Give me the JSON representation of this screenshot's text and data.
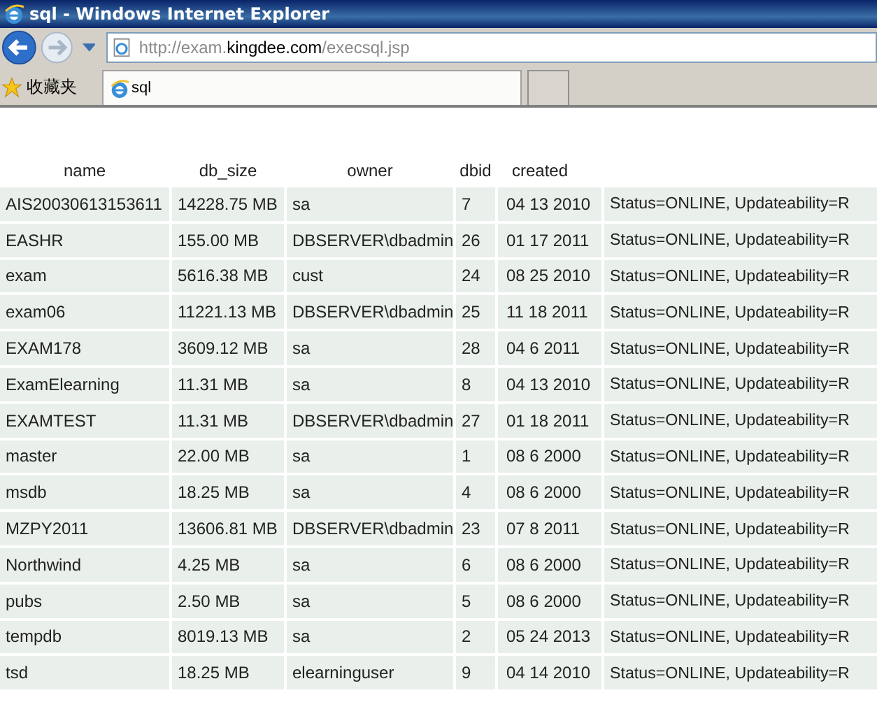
{
  "window": {
    "title": "sql - Windows Internet Explorer"
  },
  "address_bar": {
    "host_prefix": "http://exam.",
    "domain": "kingdee.com",
    "path": "/execsql.jsp"
  },
  "favorites_bar": {
    "label": "收藏夹"
  },
  "tabs": [
    {
      "label": "sql",
      "selected": true
    }
  ],
  "table": {
    "columns": [
      "name",
      "db_size",
      "owner",
      "dbid",
      "created"
    ],
    "rows": [
      [
        "AIS20030613153611",
        "14228.75 MB",
        "sa",
        "7",
        "04 13 2010",
        "Status=ONLINE, Updateability=R"
      ],
      [
        "EASHR",
        "155.00 MB",
        "DBSERVER\\dbadmin",
        "26",
        "01 17 2011",
        "Status=ONLINE, Updateability=R"
      ],
      [
        "exam",
        "5616.38 MB",
        "cust",
        "24",
        "08 25 2010",
        "Status=ONLINE, Updateability=R"
      ],
      [
        "exam06",
        "11221.13 MB",
        "DBSERVER\\dbadmin",
        "25",
        "11 18 2011",
        "Status=ONLINE, Updateability=R"
      ],
      [
        "EXAM178",
        "3609.12 MB",
        "sa",
        "28",
        "04 6 2011",
        "Status=ONLINE, Updateability=R"
      ],
      [
        "ExamElearning",
        "11.31 MB",
        "sa",
        "8",
        "04 13 2010",
        "Status=ONLINE, Updateability=R"
      ],
      [
        "EXAMTEST",
        "11.31 MB",
        "DBSERVER\\dbadmin",
        "27",
        "01 18 2011",
        "Status=ONLINE, Updateability=R"
      ],
      [
        "master",
        "22.00 MB",
        "sa",
        "1",
        "08 6 2000",
        "Status=ONLINE, Updateability=R"
      ],
      [
        "msdb",
        "18.25 MB",
        "sa",
        "4",
        "08 6 2000",
        "Status=ONLINE, Updateability=R"
      ],
      [
        "MZPY2011",
        "13606.81 MB",
        "DBSERVER\\dbadmin",
        "23",
        "07 8 2011",
        "Status=ONLINE, Updateability=R"
      ],
      [
        "Northwind",
        "4.25 MB",
        "sa",
        "6",
        "08 6 2000",
        "Status=ONLINE, Updateability=R"
      ],
      [
        "pubs",
        "2.50 MB",
        "sa",
        "5",
        "08 6 2000",
        "Status=ONLINE, Updateability=R"
      ],
      [
        "tempdb",
        "8019.13 MB",
        "sa",
        "2",
        "05 24 2013",
        "Status=ONLINE, Updateability=R"
      ],
      [
        "tsd",
        "18.25 MB",
        "elearninguser",
        "9",
        "04 14 2010",
        "Status=ONLINE, Updateability=R"
      ]
    ]
  }
}
